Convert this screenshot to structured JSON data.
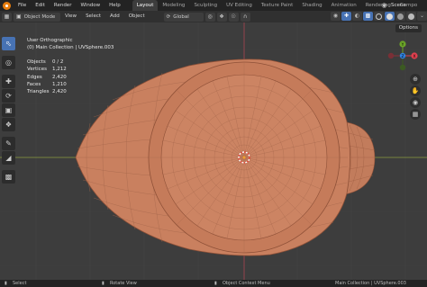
{
  "menus": [
    "File",
    "Edit",
    "Render",
    "Window",
    "Help"
  ],
  "workspaces": [
    "Layout",
    "Modeling",
    "Sculpting",
    "UV Editing",
    "Texture Paint",
    "Shading",
    "Animation",
    "Rendering",
    "Compo"
  ],
  "scene": "Scene",
  "header": {
    "mode": "Object Mode",
    "menus": [
      "View",
      "Select",
      "Add",
      "Object"
    ],
    "orientation": "Global"
  },
  "viewport": {
    "view_name": "User Orthographic",
    "collection": "(0) Main Collection | UVSphere.003",
    "stats": [
      {
        "label": "Objects",
        "value": "0 / 2"
      },
      {
        "label": "Vertices",
        "value": "1,212"
      },
      {
        "label": "Edges",
        "value": "2,420"
      },
      {
        "label": "Faces",
        "value": "1,210"
      },
      {
        "label": "Triangles",
        "value": "2,420"
      }
    ],
    "options_label": "Options",
    "gizmo_axes": {
      "x": "X",
      "y": "Y",
      "z": "Z"
    }
  },
  "statusbar": {
    "select": "Select",
    "rotate": "Rotate View",
    "context": "Object Context Menu",
    "right_info": "Main Collection | UVSphere.003"
  },
  "colors": {
    "mesh": "#c9805f",
    "viewport_bg": "#3d3d3d",
    "accent": "#4772b3",
    "axis_x": "#e0404f",
    "axis_y": "#6ba528",
    "axis_z": "#2f83e3"
  }
}
